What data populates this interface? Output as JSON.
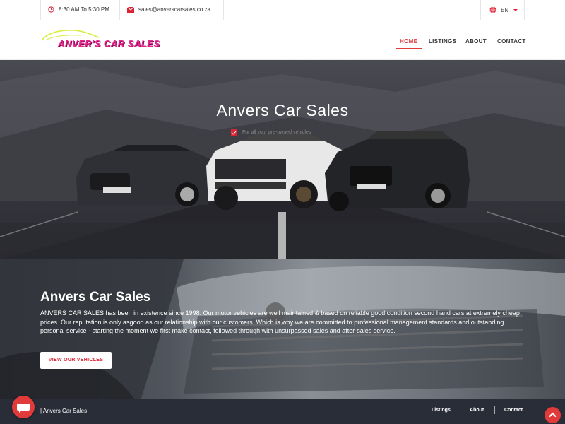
{
  "topbar": {
    "hours": "8:30 AM To 5:30 PM",
    "email": "sales@anverscarsales.co.za",
    "language": "EN"
  },
  "header": {
    "logo_text": "ANVER'S CAR SALES",
    "nav": {
      "home": "HOME",
      "listings": "LISTINGS",
      "about": "ABOUT",
      "contact": "CONTACT"
    }
  },
  "hero": {
    "title": "Anvers Car Sales",
    "subtitle": "For all your pre-owned vehicles"
  },
  "about": {
    "title": "Anvers Car Sales",
    "body": "ANVERS CAR SALES has been in existence since 1998. Our motor vehicles are well maintained & based on reliable good condition second hand cars at extremely cheap prices. Our reputation is only asgood as our relationship with our customers. Which is why we are committed to professional management standards and outstanding personal service - starting the moment we first make contact, followed through with unsurpassed sales and after-sales service.",
    "button": "VIEW OUR VEHICLES"
  },
  "footer": {
    "brand": "| Anvers Car Sales",
    "links": {
      "listings": "Listings",
      "about": "About",
      "contact": "Contact"
    }
  },
  "colors": {
    "accent": "#e03a3a",
    "logo_pink": "#e8258f",
    "footer_bg": "#292d38"
  }
}
